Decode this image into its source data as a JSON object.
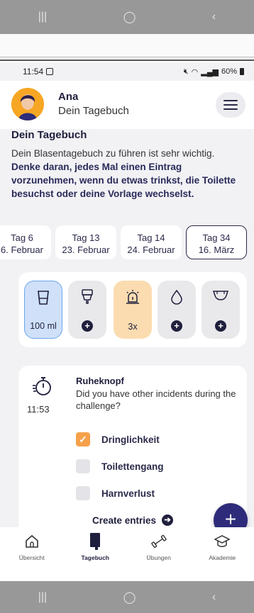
{
  "system_nav": {
    "recents": "|||",
    "home": "◯",
    "back": "‹"
  },
  "status_bar": {
    "time": "11:54",
    "battery": "60%"
  },
  "header": {
    "name": "Ana",
    "subtitle": "Dein Tagebuch"
  },
  "intro": {
    "title": "Dein Tagebuch",
    "text": "Dein Blasentagebuch zu führen ist sehr wichtig.",
    "bold_text": "Denke daran, jedes Mal einen Eintrag vorzunehmen, wenn du etwas trinkst, die Toilette besuchst oder deine Vorlage wechselst."
  },
  "days": [
    {
      "day": "Tag 6",
      "date": "6. Februar"
    },
    {
      "day": "Tag 13",
      "date": "23. Februar"
    },
    {
      "day": "Tag 14",
      "date": "24. Februar"
    },
    {
      "day": "Tag 34",
      "date": "16. März",
      "active": true
    }
  ],
  "tiles": {
    "drink": "100 ml",
    "toilet": "+",
    "urgency": "3x",
    "leak": "+",
    "pad": "+"
  },
  "incident": {
    "time": "11:53",
    "title": "Ruheknopf",
    "question": "Did you have other incidents during the challenge?",
    "options": [
      {
        "label": "Dringlichkeit",
        "checked": true
      },
      {
        "label": "Toilettengang",
        "checked": false
      },
      {
        "label": "Harnverlust",
        "checked": false
      }
    ],
    "create_label": "Create entries"
  },
  "fab_label": "+",
  "bottom_nav": [
    {
      "label": "Übersicht",
      "icon": "home-icon"
    },
    {
      "label": "Tagebuch",
      "icon": "diary-icon",
      "active": true
    },
    {
      "label": "Übungen",
      "icon": "dumbbell-icon"
    },
    {
      "label": "Akademie",
      "icon": "graduation-cap-icon"
    }
  ],
  "colors": {
    "accent": "#2e2c7a",
    "orange": "#f6a14a",
    "blue_tile": "#cfe0f8"
  }
}
